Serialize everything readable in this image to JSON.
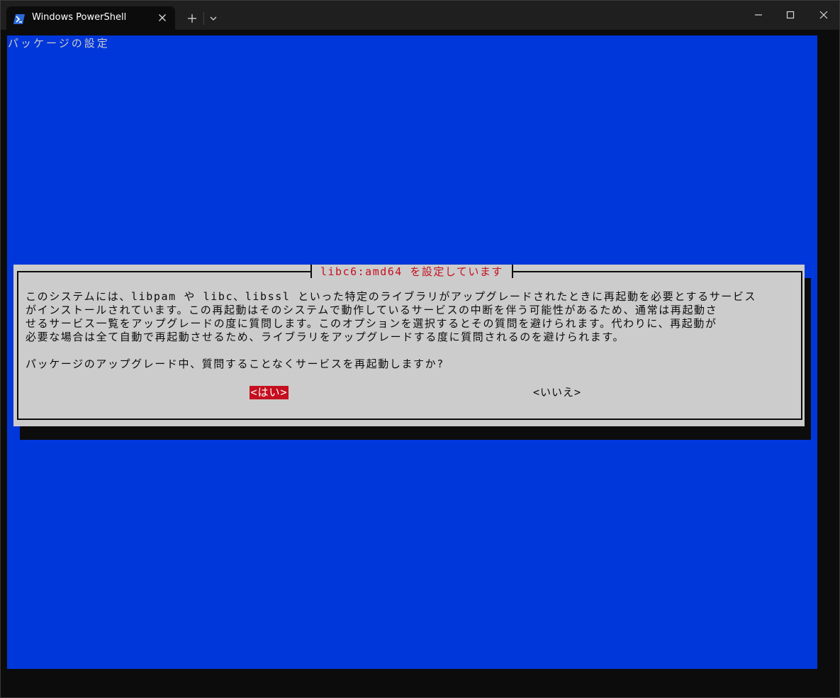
{
  "window": {
    "tab_title": "Windows PowerShell",
    "tab_icon": "powershell-icon",
    "close_tab_icon": "close-icon",
    "new_tab_icon": "plus-icon",
    "dropdown_icon": "chevron-down-icon",
    "minimize_icon": "minimize-icon",
    "maximize_icon": "maximize-icon",
    "close_window_icon": "close-icon"
  },
  "terminal": {
    "screen_title": "パッケージの設定",
    "background_color": "#0037da",
    "dialog": {
      "title": "libc6:amd64 を設定しています",
      "lines": [
        "このシステムには、libpam や libc、libssl といった特定のライブラリがアップグレードされたときに再起動を必要とするサービス",
        "がインストールされています。この再起動はそのシステムで動作しているサービスの中断を伴う可能性があるため、通常は再起動さ",
        "せるサービス一覧をアップグレードの度に質問します。このオプションを選択するとその質問を避けられます。代わりに、再起動が",
        "必要な場合は全て自動で再起動させるため、ライブラリをアップグレードする度に質問されるのを避けられます。"
      ],
      "question": "パッケージのアップグレード中、質問することなくサービスを再起動しますか?",
      "yes_label": "<はい>",
      "no_label": "<いいえ>",
      "selected_color": "#c50f1f"
    }
  }
}
